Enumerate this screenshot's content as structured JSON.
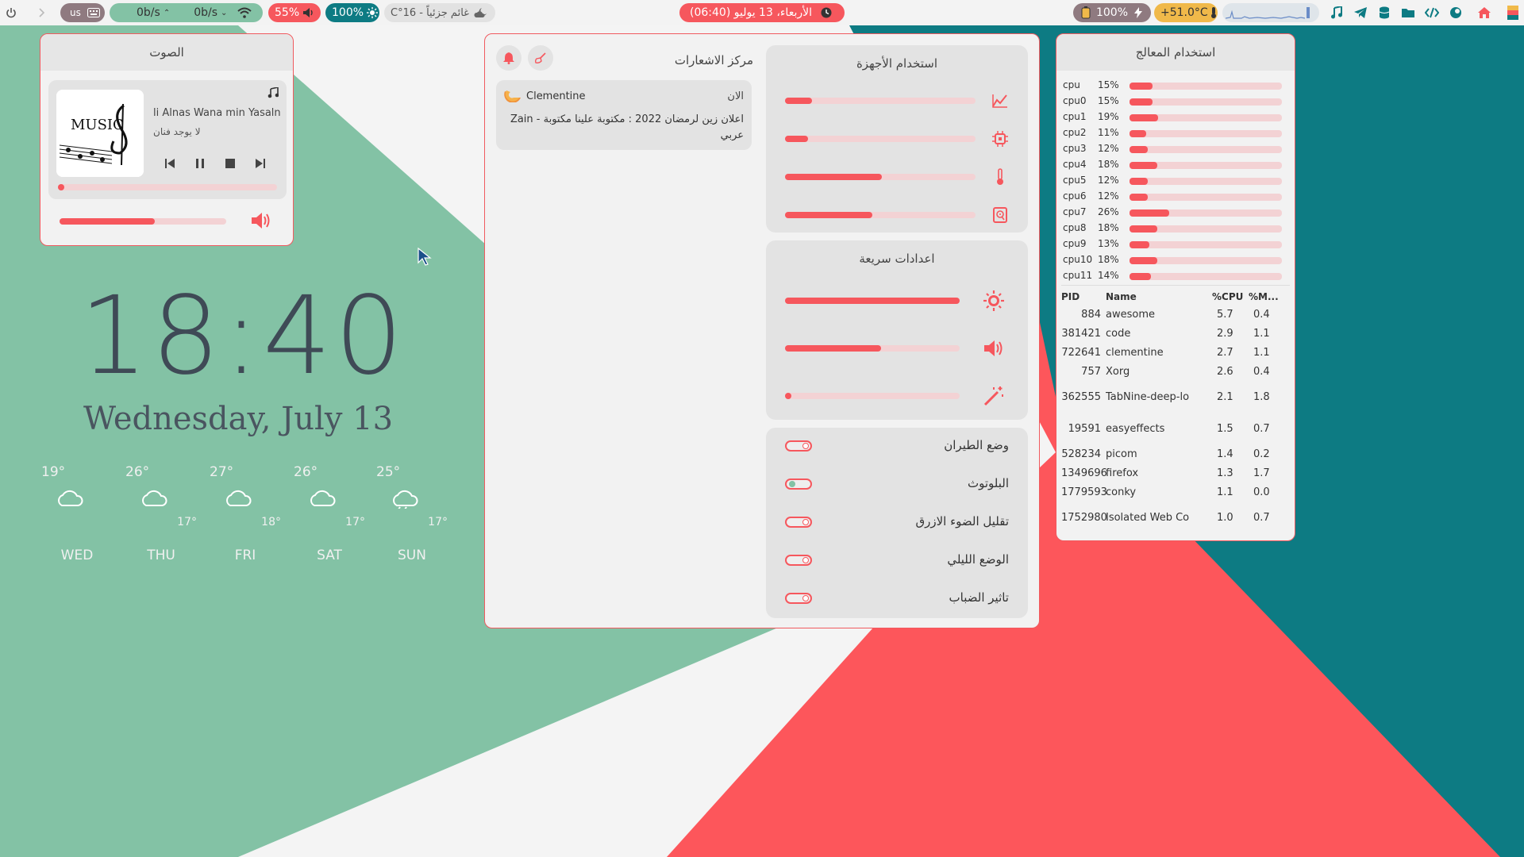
{
  "colors": {
    "accent": "#f6575d",
    "green_bg": "#83c2a5",
    "teal_bg": "#0d7b83",
    "red_bg": "#fd565b",
    "panel": "#f2f2f2"
  },
  "topbar": {
    "left": {
      "power_icon": "power-icon",
      "chevron_icon": "chevron-right-icon",
      "keyboard_layout": "us",
      "net_up": "0b/s",
      "net_down": "0b/s",
      "volume": "55%",
      "brightness": "100%",
      "weather": "غائم جزئياً - 16°C"
    },
    "center": {
      "datetime": "الأربعاء، 13 يوليو (06:40)"
    },
    "right": {
      "battery": "100%",
      "temperature": "+51.0°C"
    }
  },
  "volume_widget": {
    "title": "الصوت",
    "album_text": "MUSIC",
    "track_title": "li Alnas  Wana min Yasalni",
    "artist": "لا يوجد فنان",
    "track_progress": 0.03,
    "volume_level": 0.57
  },
  "clock": {
    "time": "18:40",
    "date": "Wednesday, July 13"
  },
  "forecast": [
    {
      "day": "WED",
      "high": "19°",
      "low": ""
    },
    {
      "day": "THU",
      "high": "26°",
      "low": "17°"
    },
    {
      "day": "FRI",
      "high": "27°",
      "low": "18°"
    },
    {
      "day": "SAT",
      "high": "26°",
      "low": "17°"
    },
    {
      "day": "SUN",
      "high": "25°",
      "low": "17°"
    }
  ],
  "notifications": {
    "title": "مركز الاشعارات",
    "items": [
      {
        "app": "Clementine",
        "time": "الان",
        "body": "اعلان زين لرمضان 2022 : مكتوبة علينا مكتوبة - Zain عربي"
      }
    ]
  },
  "hardware": {
    "title": "استخدام الأجهزة",
    "bars": [
      {
        "icon": "chart-icon",
        "level": 0.14
      },
      {
        "icon": "cpu-chip-icon",
        "level": 0.12
      },
      {
        "icon": "thermometer-icon",
        "level": 0.51
      },
      {
        "icon": "disk-icon",
        "level": 0.46
      }
    ]
  },
  "quick_settings": {
    "title": "اعدادات سريعة",
    "sliders": [
      {
        "icon": "brightness-icon",
        "level": 1.0
      },
      {
        "icon": "volume-icon",
        "level": 0.55
      },
      {
        "icon": "magic-wand-icon",
        "level": 0.02
      }
    ],
    "toggles": [
      {
        "label": "وضع الطيران",
        "on": false
      },
      {
        "label": "البلوتوث",
        "on": true
      },
      {
        "label": "تقليل الضوء الازرق",
        "on": false
      },
      {
        "label": "الوضع الليلي",
        "on": false
      },
      {
        "label": "تاثير الضباب",
        "on": false
      }
    ]
  },
  "cpu_panel": {
    "title": "استخدام المعالج",
    "cores": [
      {
        "name": "cpu",
        "percent": "15%",
        "value": 15
      },
      {
        "name": "cpu0",
        "percent": "15%",
        "value": 15
      },
      {
        "name": "cpu1",
        "percent": "19%",
        "value": 19
      },
      {
        "name": "cpu2",
        "percent": "11%",
        "value": 11
      },
      {
        "name": "cpu3",
        "percent": "12%",
        "value": 12
      },
      {
        "name": "cpu4",
        "percent": "18%",
        "value": 18
      },
      {
        "name": "cpu5",
        "percent": "12%",
        "value": 12
      },
      {
        "name": "cpu6",
        "percent": "12%",
        "value": 12
      },
      {
        "name": "cpu7",
        "percent": "26%",
        "value": 26
      },
      {
        "name": "cpu8",
        "percent": "18%",
        "value": 18
      },
      {
        "name": "cpu9",
        "percent": "13%",
        "value": 13
      },
      {
        "name": "cpu10",
        "percent": "18%",
        "value": 18
      },
      {
        "name": "cpu11",
        "percent": "14%",
        "value": 14
      }
    ],
    "columns": [
      "PID",
      "Name",
      "%CPU",
      "%M..."
    ],
    "processes": [
      {
        "pid": "884",
        "name": "awesome",
        "cpu": "5.7",
        "mem": "0.4"
      },
      {
        "pid": "381421",
        "name": "code",
        "cpu": "2.9",
        "mem": "1.1"
      },
      {
        "pid": "722641",
        "name": "clementine",
        "cpu": "2.7",
        "mem": "1.1"
      },
      {
        "pid": "757",
        "name": "Xorg",
        "cpu": "2.6",
        "mem": "0.4"
      },
      {
        "pid": "362555",
        "name": "TabNine-deep-lo",
        "cpu": "2.1",
        "mem": "1.8"
      },
      {
        "pid": "19591",
        "name": "easyeffects",
        "cpu": "1.5",
        "mem": "0.7"
      },
      {
        "pid": "528234",
        "name": "picom",
        "cpu": "1.4",
        "mem": "0.2"
      },
      {
        "pid": "1349696",
        "name": "firefox",
        "cpu": "1.3",
        "mem": "1.7"
      },
      {
        "pid": "1779593",
        "name": "conky",
        "cpu": "1.1",
        "mem": "0.0"
      },
      {
        "pid": "1752980",
        "name": "Isolated Web Co",
        "cpu": "1.0",
        "mem": "0.7"
      }
    ]
  }
}
